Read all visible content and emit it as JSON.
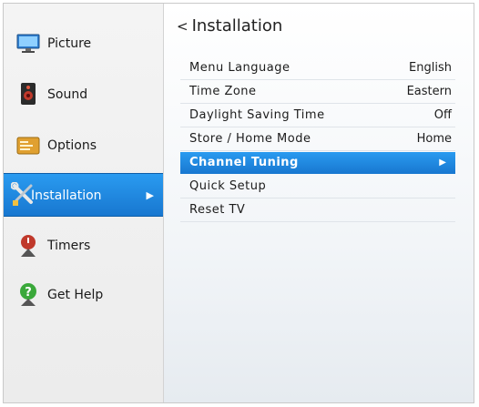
{
  "sidebar": {
    "items": [
      {
        "label": "Picture",
        "icon": "monitor-icon"
      },
      {
        "label": "Sound",
        "icon": "speaker-icon"
      },
      {
        "label": "Options",
        "icon": "options-panel-icon"
      },
      {
        "label": "Installation",
        "icon": "wrench-screwdriver-icon",
        "selected": true,
        "arrow": "▶"
      },
      {
        "label": "Timers",
        "icon": "timer-icon"
      },
      {
        "label": "Get Help",
        "icon": "help-icon"
      }
    ]
  },
  "panel": {
    "back_chevron": "<",
    "title": "Installation",
    "rows": [
      {
        "label": "Menu Language",
        "value": "English"
      },
      {
        "label": "Time Zone",
        "value": "Eastern"
      },
      {
        "label": "Daylight Saving Time",
        "value": "Off"
      },
      {
        "label": "Store / Home Mode",
        "value": "Home"
      },
      {
        "label": "Channel Tuning",
        "value": "▶",
        "selected": true
      },
      {
        "label": "Quick Setup",
        "value": ""
      },
      {
        "label": "Reset TV",
        "value": ""
      }
    ]
  },
  "colors": {
    "highlight": "#1e88e0",
    "text": "#1c1c1c"
  }
}
